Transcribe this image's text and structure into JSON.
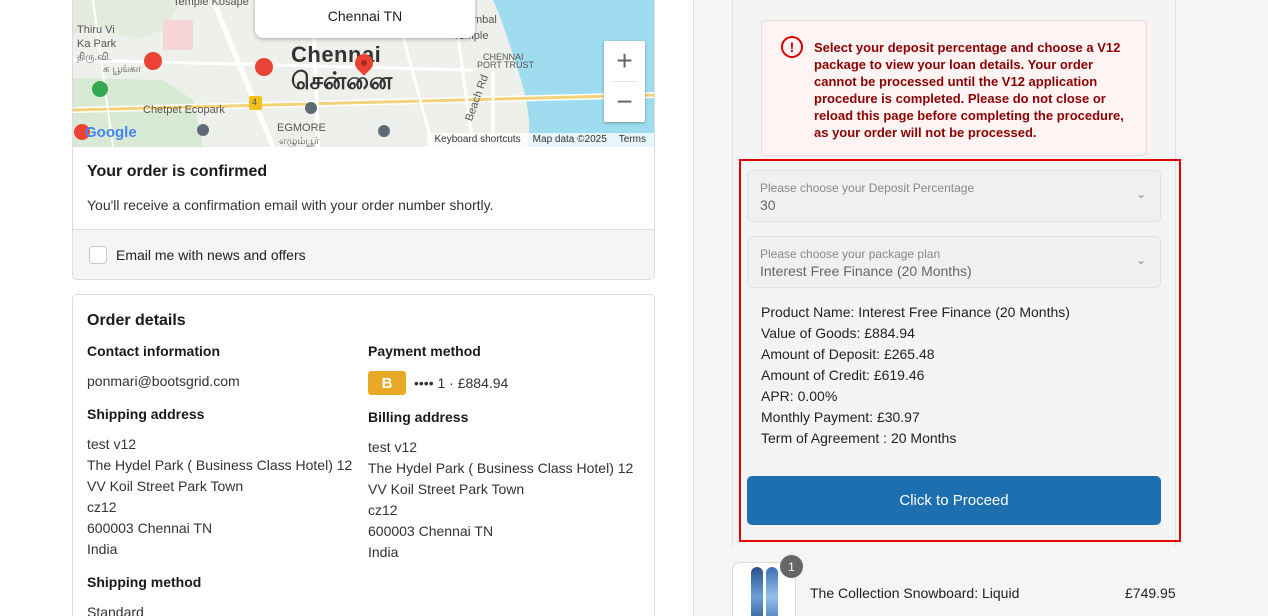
{
  "map": {
    "popup_text": "Chennai TN",
    "city_name_en": "Chennai",
    "city_name_ta": "சென்னை",
    "labels": {
      "temple_kosapet": "Temple Kosape",
      "thiru_vi": "Thiru Vi",
      "ka_park": "Ka Park",
      "ta_park": "திரு.வி.",
      "ta_park2": "க பூங்கா",
      "chetpet": "Chetpet Ecopark",
      "egmore": "EGMORE",
      "egmore_ta": "எழும்பூர்",
      "chennai_port": "CHENNAI",
      "port_trust": "PORT TRUST",
      "beach_rd": "Beach Rd",
      "temple": "Temple",
      "mbal": "mbal",
      "route": "4"
    },
    "zoom_in": "+",
    "zoom_out": "−",
    "attr_keyboard": "Keyboard shortcuts",
    "attr_data": "Map data ©2025",
    "attr_terms": "Terms",
    "google": "Google"
  },
  "confirmation": {
    "title": "Your order is confirmed",
    "subtitle": "You'll receive a confirmation email with your order number shortly.",
    "news_label": "Email me with news and offers"
  },
  "order": {
    "title": "Order details",
    "contact_heading": "Contact information",
    "contact_email": "ponmari@bootsgrid.com",
    "payment_heading": "Payment method",
    "payment_badge": "B",
    "payment_text": "•••• 1 · £884.94",
    "shipping_heading": "Shipping address",
    "shipping_lines": [
      "test v12",
      "The Hydel Park ( Business Class Hotel) 12",
      "VV Koil Street Park Town",
      "cz12",
      "600003 Chennai TN",
      "India"
    ],
    "billing_heading": "Billing address",
    "billing_lines": [
      "test v12",
      "The Hydel Park ( Business Class Hotel) 12",
      "VV Koil Street Park Town",
      "cz12",
      "600003 Chennai TN",
      "India"
    ],
    "method_heading": "Shipping method",
    "method_value": "Standard"
  },
  "finance": {
    "alert_icon": "!",
    "alert_text": "Select your deposit percentage and choose a V12 package to view your loan details. Your order cannot be processed until the V12 application procedure is completed. Please do not close or reload this page before completing the procedure, as your order will not be processed.",
    "deposit_label": "Please choose your Deposit Percentage",
    "deposit_value": "30",
    "plan_label": "Please choose your package plan",
    "plan_value": "Interest Free Finance (20 Months)",
    "details": [
      "Product Name: Interest Free Finance (20 Months)",
      "Value of Goods: £884.94",
      "Amount of Deposit: £265.48",
      "Amount of Credit: £619.46",
      "APR: 0.00%",
      "Monthly Payment: £30.97",
      "Term of Agreement : 20 Months"
    ],
    "proceed_label": "Click to Proceed",
    "chevron": "⌄"
  },
  "cart": {
    "quantity": "1",
    "product_name": "The Collection Snowboard: Liquid",
    "product_price": "£749.95"
  }
}
